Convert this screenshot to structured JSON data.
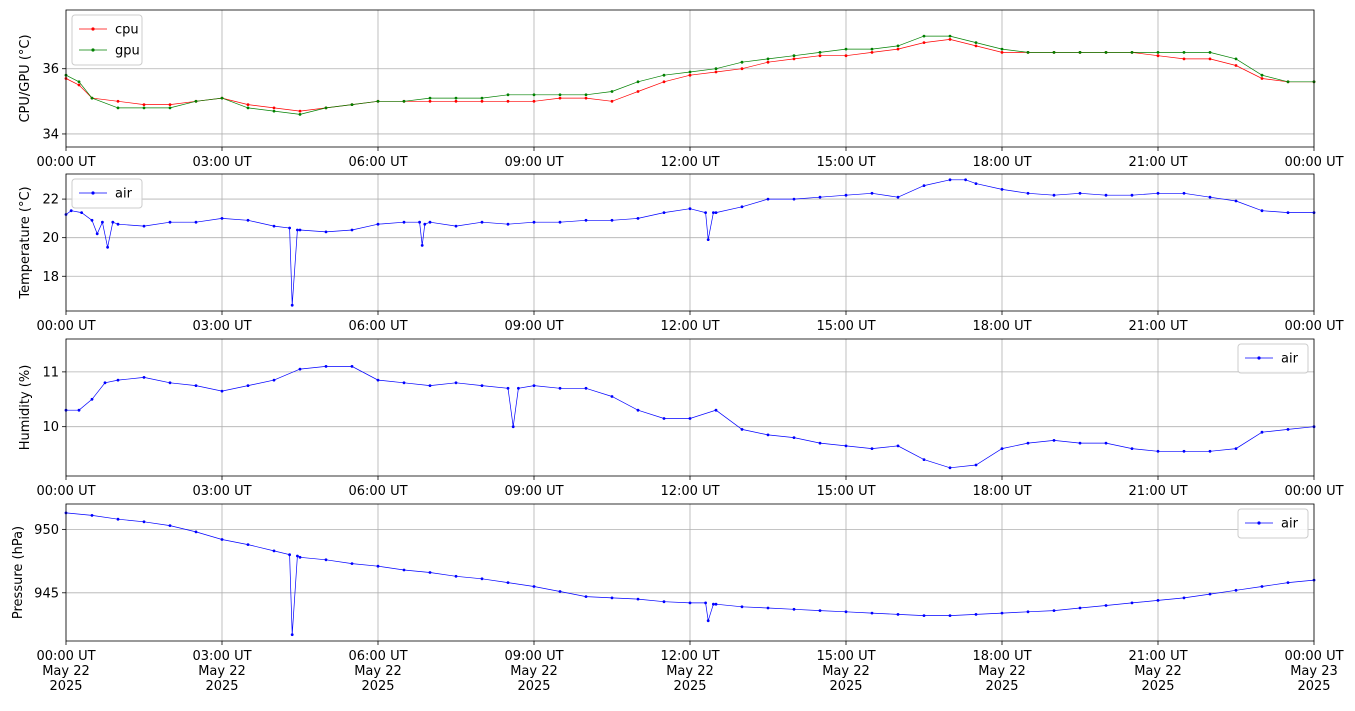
{
  "chart_data": [
    {
      "type": "line",
      "ylabel": "CPU/GPU (°C)",
      "ylim": [
        33.6,
        37.8
      ],
      "yticks": [
        34,
        36
      ],
      "x_ticks": [
        "00:00 UT",
        "03:00 UT",
        "06:00 UT",
        "09:00 UT",
        "12:00 UT",
        "15:00 UT",
        "18:00 UT",
        "21:00 UT",
        "00:00 UT"
      ],
      "x_hours": [
        0,
        24
      ],
      "grid": true,
      "legend": "top-left",
      "series": [
        {
          "name": "cpu",
          "color": "#ff0000",
          "x": [
            0,
            0.25,
            0.5,
            1,
            1.5,
            2,
            2.5,
            3,
            3.5,
            4,
            4.5,
            5,
            5.5,
            6,
            6.5,
            7,
            7.5,
            8,
            8.5,
            9,
            9.5,
            10,
            10.5,
            11,
            11.5,
            12,
            12.5,
            13,
            13.5,
            14,
            14.5,
            15,
            15.5,
            16,
            16.5,
            17,
            17.5,
            18,
            18.5,
            19,
            19.5,
            20,
            20.5,
            21,
            21.5,
            22,
            22.5,
            23,
            23.5,
            24
          ],
          "values": [
            35.7,
            35.5,
            35.1,
            35.0,
            34.9,
            34.9,
            35.0,
            35.1,
            34.9,
            34.8,
            34.7,
            34.8,
            34.9,
            35.0,
            35.0,
            35.0,
            35.0,
            35.0,
            35.0,
            35.0,
            35.1,
            35.1,
            35.0,
            35.3,
            35.6,
            35.8,
            35.9,
            36.0,
            36.2,
            36.3,
            36.4,
            36.4,
            36.5,
            36.6,
            36.8,
            36.9,
            36.7,
            36.5,
            36.5,
            36.5,
            36.5,
            36.5,
            36.5,
            36.4,
            36.3,
            36.3,
            36.1,
            35.7,
            35.6,
            35.6
          ]
        },
        {
          "name": "gpu",
          "color": "#008000",
          "x": [
            0,
            0.25,
            0.5,
            1,
            1.5,
            2,
            2.5,
            3,
            3.5,
            4,
            4.5,
            5,
            5.5,
            6,
            6.5,
            7,
            7.5,
            8,
            8.5,
            9,
            9.5,
            10,
            10.5,
            11,
            11.5,
            12,
            12.5,
            13,
            13.5,
            14,
            14.5,
            15,
            15.5,
            16,
            16.5,
            17,
            17.5,
            18,
            18.5,
            19,
            19.5,
            20,
            20.5,
            21,
            21.5,
            22,
            22.5,
            23,
            23.5,
            24
          ],
          "values": [
            35.8,
            35.6,
            35.1,
            34.8,
            34.8,
            34.8,
            35.0,
            35.1,
            34.8,
            34.7,
            34.6,
            34.8,
            34.9,
            35.0,
            35.0,
            35.1,
            35.1,
            35.1,
            35.2,
            35.2,
            35.2,
            35.2,
            35.3,
            35.6,
            35.8,
            35.9,
            36.0,
            36.2,
            36.3,
            36.4,
            36.5,
            36.6,
            36.6,
            36.7,
            37.0,
            37.0,
            36.8,
            36.6,
            36.5,
            36.5,
            36.5,
            36.5,
            36.5,
            36.5,
            36.5,
            36.5,
            36.3,
            35.8,
            35.6,
            35.6
          ]
        }
      ]
    },
    {
      "type": "line",
      "ylabel": "Temperature (°C)",
      "ylim": [
        16.2,
        23.3
      ],
      "yticks": [
        18,
        20,
        22
      ],
      "x_ticks": [
        "00:00 UT",
        "03:00 UT",
        "06:00 UT",
        "09:00 UT",
        "12:00 UT",
        "15:00 UT",
        "18:00 UT",
        "21:00 UT",
        "00:00 UT"
      ],
      "x_hours": [
        0,
        24
      ],
      "grid": true,
      "legend": "top-left",
      "series": [
        {
          "name": "air",
          "color": "#0000ff",
          "x": [
            0,
            0.1,
            0.3,
            0.5,
            0.6,
            0.7,
            0.8,
            0.9,
            1.0,
            1.5,
            2.0,
            2.5,
            3.0,
            3.5,
            4.0,
            4.3,
            4.35,
            4.45,
            4.5,
            5.0,
            5.5,
            6.0,
            6.5,
            6.8,
            6.85,
            6.9,
            7.0,
            7.5,
            8.0,
            8.5,
            9.0,
            9.5,
            10.0,
            10.5,
            11.0,
            11.5,
            12.0,
            12.3,
            12.35,
            12.45,
            12.5,
            13.0,
            13.5,
            14.0,
            14.5,
            15.0,
            15.5,
            16.0,
            16.5,
            17.0,
            17.3,
            17.5,
            18.0,
            18.5,
            19.0,
            19.5,
            20.0,
            20.5,
            21.0,
            21.5,
            22.0,
            22.5,
            23.0,
            23.5,
            24.0
          ],
          "values": [
            21.2,
            21.4,
            21.3,
            20.9,
            20.2,
            20.8,
            19.5,
            20.8,
            20.7,
            20.6,
            20.8,
            20.8,
            21.0,
            20.9,
            20.6,
            20.5,
            16.5,
            20.4,
            20.4,
            20.3,
            20.4,
            20.7,
            20.8,
            20.8,
            19.6,
            20.7,
            20.8,
            20.6,
            20.8,
            20.7,
            20.8,
            20.8,
            20.9,
            20.9,
            21.0,
            21.3,
            21.5,
            21.3,
            19.9,
            21.3,
            21.3,
            21.6,
            22.0,
            22.0,
            22.1,
            22.2,
            22.3,
            22.1,
            22.7,
            23.0,
            23.0,
            22.8,
            22.5,
            22.3,
            22.2,
            22.3,
            22.2,
            22.2,
            22.3,
            22.3,
            22.1,
            21.9,
            21.4,
            21.3,
            21.3
          ]
        }
      ]
    },
    {
      "type": "line",
      "ylabel": "Humidity (%)",
      "ylim": [
        9.1,
        11.6
      ],
      "yticks": [
        10,
        11
      ],
      "x_ticks": [
        "00:00 UT",
        "03:00 UT",
        "06:00 UT",
        "09:00 UT",
        "12:00 UT",
        "15:00 UT",
        "18:00 UT",
        "21:00 UT",
        "00:00 UT"
      ],
      "x_hours": [
        0,
        24
      ],
      "grid": true,
      "legend": "top-right",
      "series": [
        {
          "name": "air",
          "color": "#0000ff",
          "x": [
            0,
            0.25,
            0.5,
            0.75,
            1.0,
            1.5,
            2.0,
            2.5,
            3.0,
            3.5,
            4.0,
            4.5,
            5.0,
            5.5,
            6.0,
            6.5,
            7.0,
            7.5,
            8.0,
            8.5,
            8.6,
            8.7,
            9.0,
            9.5,
            10.0,
            10.5,
            11.0,
            11.5,
            12.0,
            12.5,
            13.0,
            13.5,
            14.0,
            14.5,
            15.0,
            15.5,
            16.0,
            16.5,
            17.0,
            17.5,
            18.0,
            18.5,
            19.0,
            19.5,
            20.0,
            20.5,
            21.0,
            21.5,
            22.0,
            22.5,
            23.0,
            23.5,
            24.0
          ],
          "values": [
            10.3,
            10.3,
            10.5,
            10.8,
            10.85,
            10.9,
            10.8,
            10.75,
            10.65,
            10.75,
            10.85,
            11.05,
            11.1,
            11.1,
            10.85,
            10.8,
            10.75,
            10.8,
            10.75,
            10.7,
            10.0,
            10.7,
            10.75,
            10.7,
            10.7,
            10.55,
            10.3,
            10.15,
            10.15,
            10.3,
            9.95,
            9.85,
            9.8,
            9.7,
            9.65,
            9.6,
            9.65,
            9.4,
            9.25,
            9.3,
            9.6,
            9.7,
            9.75,
            9.7,
            9.7,
            9.6,
            9.55,
            9.55,
            9.55,
            9.6,
            9.9,
            9.95,
            10.0
          ]
        }
      ]
    },
    {
      "type": "line",
      "ylabel": "Pressure (hPa)",
      "ylim": [
        941.2,
        952.0
      ],
      "yticks": [
        945,
        950
      ],
      "x_ticks": [
        "00:00 UT\nMay 22\n2025",
        "03:00 UT\nMay 22\n2025",
        "06:00 UT\nMay 22\n2025",
        "09:00 UT\nMay 22\n2025",
        "12:00 UT\nMay 22\n2025",
        "15:00 UT\nMay 22\n2025",
        "18:00 UT\nMay 22\n2025",
        "21:00 UT\nMay 22\n2025",
        "00:00 UT\nMay 23\n2025"
      ],
      "x_hours": [
        0,
        24
      ],
      "grid": true,
      "legend": "top-right",
      "series": [
        {
          "name": "air",
          "color": "#0000ff",
          "x": [
            0,
            0.5,
            1.0,
            1.5,
            2.0,
            2.5,
            3.0,
            3.5,
            4.0,
            4.3,
            4.35,
            4.45,
            4.5,
            5.0,
            5.5,
            6.0,
            6.5,
            7.0,
            7.5,
            8.0,
            8.5,
            9.0,
            9.5,
            10.0,
            10.5,
            11.0,
            11.5,
            12.0,
            12.3,
            12.35,
            12.45,
            12.5,
            13.0,
            13.5,
            14.0,
            14.5,
            15.0,
            15.5,
            16.0,
            16.5,
            17.0,
            17.5,
            18.0,
            18.5,
            19.0,
            19.5,
            20.0,
            20.5,
            21.0,
            21.5,
            22.0,
            22.5,
            23.0,
            23.5,
            24.0
          ],
          "values": [
            951.3,
            951.1,
            950.8,
            950.6,
            950.3,
            949.8,
            949.2,
            948.8,
            948.3,
            948.0,
            941.7,
            947.9,
            947.8,
            947.6,
            947.3,
            947.1,
            946.8,
            946.6,
            946.3,
            946.1,
            945.8,
            945.5,
            945.1,
            944.7,
            944.6,
            944.5,
            944.3,
            944.2,
            944.2,
            942.8,
            944.1,
            944.1,
            943.9,
            943.8,
            943.7,
            943.6,
            943.5,
            943.4,
            943.3,
            943.2,
            943.2,
            943.3,
            943.4,
            943.5,
            943.6,
            943.8,
            944.0,
            944.2,
            944.4,
            944.6,
            944.9,
            945.2,
            945.5,
            945.8,
            946.0
          ]
        }
      ]
    }
  ]
}
